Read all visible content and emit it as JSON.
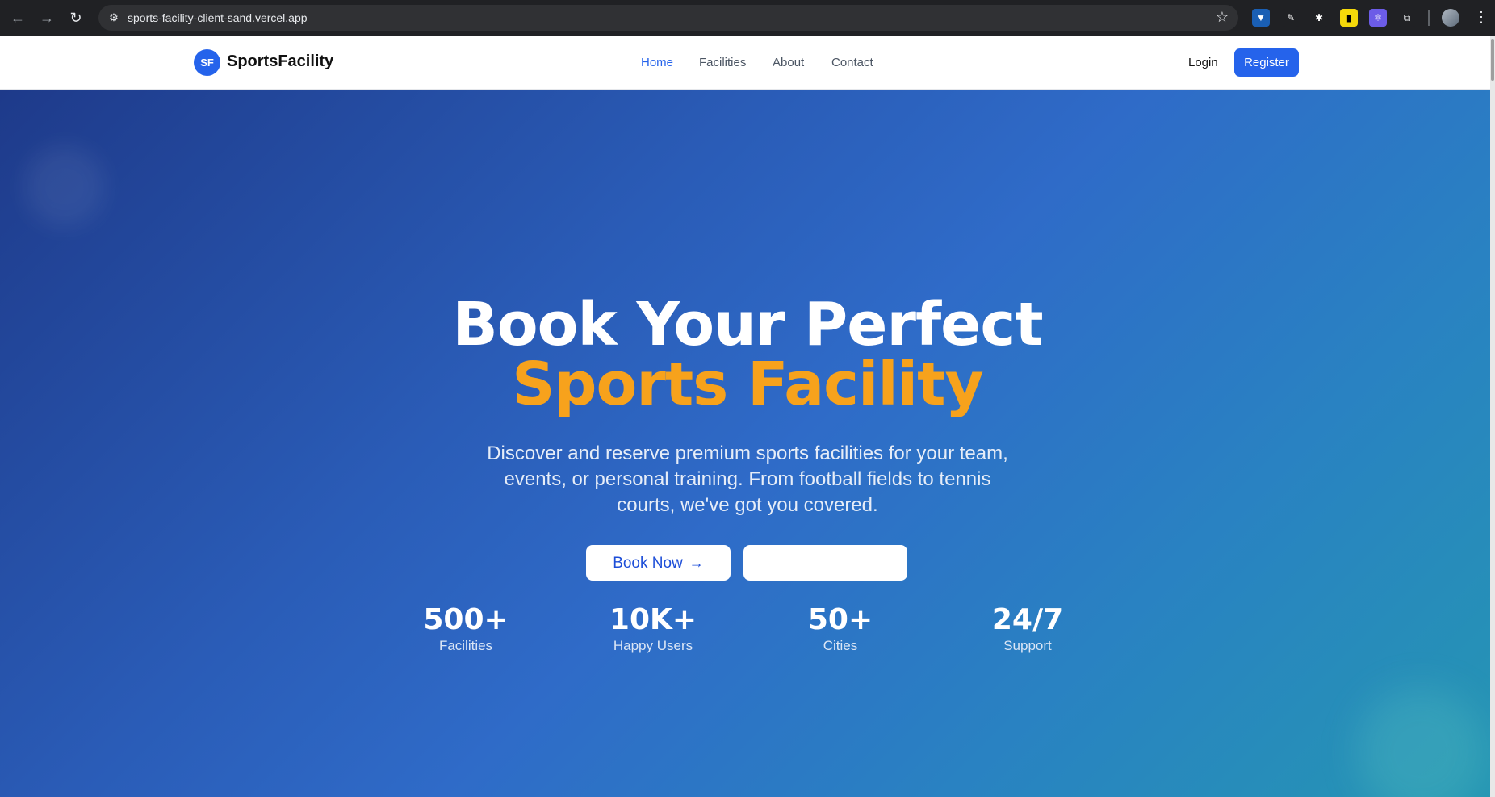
{
  "browser": {
    "url": "sports-facility-client-sand.vercel.app",
    "back_icon": "←",
    "forward_icon": "→",
    "reload_icon": "↻",
    "star_icon": "☆",
    "menu_icon": "⋮"
  },
  "header": {
    "logo_badge": "SF",
    "brand": "SportsFacility",
    "nav": [
      {
        "label": "Home"
      },
      {
        "label": "Facilities"
      },
      {
        "label": "About"
      },
      {
        "label": "Contact"
      }
    ],
    "login_label": "Login",
    "register_label": "Register",
    "accent_color": "#2563eb"
  },
  "hero": {
    "title_line1": "Book Your Perfect",
    "title_line2": "Sports Facility",
    "subtitle": "Discover and reserve premium sports facilities for your team, events, or personal training. From football fields to tennis courts, we've got you covered.",
    "primary_button": "Book Now",
    "primary_button_icon": "→",
    "secondary_button": "",
    "accent_color": "#f7a21c",
    "stats": [
      {
        "value": "500+",
        "label": "Facilities"
      },
      {
        "value": "10K+",
        "label": "Happy Users"
      },
      {
        "value": "50+",
        "label": "Cities"
      },
      {
        "value": "24/7",
        "label": "Support"
      }
    ]
  }
}
